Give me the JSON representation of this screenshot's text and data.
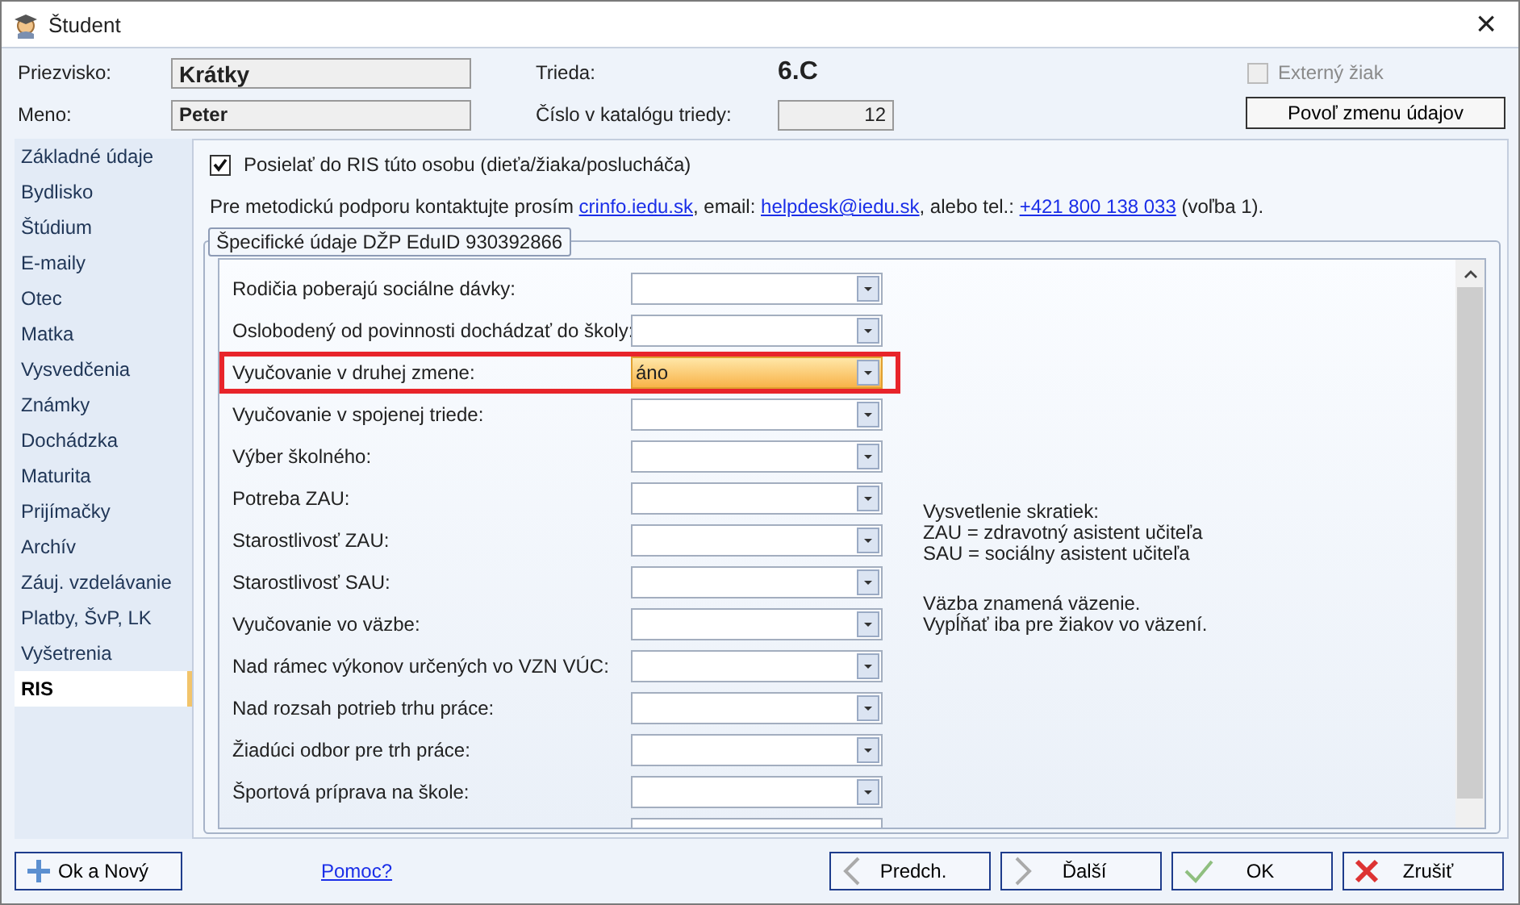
{
  "window": {
    "title": "Študent",
    "close": "×"
  },
  "header": {
    "surname_label": "Priezvisko:",
    "surname": "Krátky",
    "name_label": "Meno:",
    "name": "Peter",
    "class_label": "Trieda:",
    "class_value": "6.C",
    "catalog_label": "Číslo v katalógu triedy:",
    "catalog_value": "12",
    "external": {
      "label": "Externý žiak",
      "checked": false,
      "disabled": true
    },
    "allow_button": "Povoľ zmenu údajov"
  },
  "sidebar": {
    "items": [
      {
        "label": "Základné údaje",
        "selected": false
      },
      {
        "label": "Bydlisko",
        "selected": false
      },
      {
        "label": "Štúdium",
        "selected": false
      },
      {
        "label": "E-maily",
        "selected": false
      },
      {
        "label": "Otec",
        "selected": false
      },
      {
        "label": "Matka",
        "selected": false
      },
      {
        "label": "Vysvedčenia",
        "selected": false
      },
      {
        "label": "Známky",
        "selected": false
      },
      {
        "label": "Dochádzka",
        "selected": false
      },
      {
        "label": "Maturita",
        "selected": false
      },
      {
        "label": "Prijímačky",
        "selected": false
      },
      {
        "label": "Archív",
        "selected": false
      },
      {
        "label": "Záuj. vzdelávanie",
        "selected": false
      },
      {
        "label": "Platby, ŠvP, LK",
        "selected": false
      },
      {
        "label": "Vyšetrenia",
        "selected": false
      },
      {
        "label": "RIS",
        "selected": true
      }
    ]
  },
  "send_to_ris": {
    "label": "Posielať do RIS túto osobu (dieťa/žiaka/poslucháča)",
    "checked": true
  },
  "support_text": [
    {
      "text": "Pre metodickú podporu kontaktujte prosím ",
      "link": false
    },
    {
      "text": "crinfo.iedu.sk",
      "link": true
    },
    {
      "text": ", email: ",
      "link": false
    },
    {
      "text": "helpdesk@iedu.sk",
      "link": true
    },
    {
      "text": ", alebo tel.: ",
      "link": false
    },
    {
      "text": "+421 800 138 033",
      "link": true
    },
    {
      "text": " (voľba 1).",
      "link": false
    }
  ],
  "group": {
    "title": "Špecifické údaje DŽP EduID 930392866",
    "rows": [
      {
        "label": "Rodičia poberajú sociálne dávky:",
        "highlighted": false
      },
      {
        "label": "Oslobodený od povinnosti dochádzať do školy:",
        "highlighted": false
      },
      {
        "label": "Vyučovanie v druhej zmene:",
        "value": "áno",
        "highlighted": true
      },
      {
        "label": "Vyučovanie v spojenej triede:",
        "highlighted": false
      },
      {
        "label": "Výber školného:",
        "highlighted": false
      },
      {
        "label": "Potreba ZAU:",
        "highlighted": false
      },
      {
        "label": "Starostlivosť ZAU:",
        "highlighted": false
      },
      {
        "label": "Starostlivosť SAU:",
        "highlighted": false
      },
      {
        "label": "Vyučovanie vo väzbe:",
        "highlighted": false
      },
      {
        "label": "Nad rámec výkonov určených vo VZN VÚC:",
        "highlighted": false
      },
      {
        "label": "Nad rozsah potrieb trhu práce:",
        "highlighted": false
      },
      {
        "label": "Žiadúci odbor pre trh práce:",
        "highlighted": false
      },
      {
        "label": "Športová príprava na škole:",
        "highlighted": false
      }
    ],
    "notes": [
      [
        "Vysvetlenie skratiek:",
        "ZAU = zdravotný asistent učiteľa",
        "SAU = sociálny asistent učiteľa"
      ],
      [
        "Väzba znamená väzenie.",
        "Vypĺňať iba pre žiakov vo väzení."
      ]
    ]
  },
  "footer": {
    "buttons": [
      {
        "label": "Ok a Nový",
        "kind": "plus"
      },
      {
        "label": "Predch.",
        "kind": "prev"
      },
      {
        "label": "Ďalší",
        "kind": "next"
      },
      {
        "label": "OK",
        "kind": "ok"
      },
      {
        "label": "Zrušiť",
        "kind": "cancel"
      }
    ],
    "help_link": "Pomoc?"
  }
}
